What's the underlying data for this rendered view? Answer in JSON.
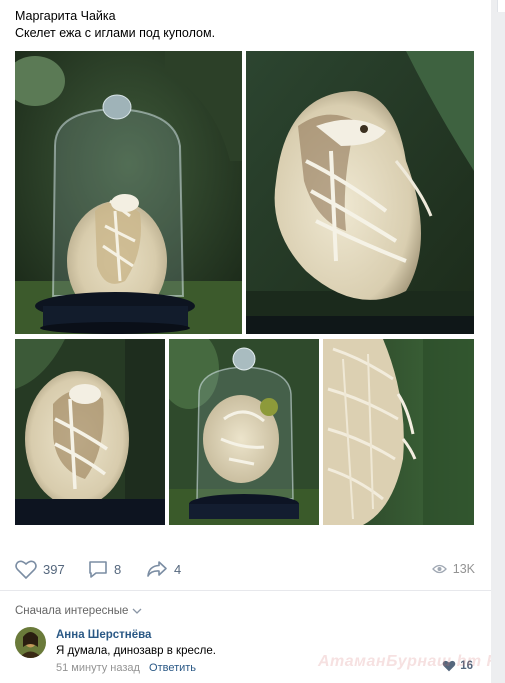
{
  "post": {
    "author": "Маргарита Чайка",
    "text": "Скелет ежа с иглами под куполом."
  },
  "photos": [
    {
      "subject": "skeleton-under-glass-dome"
    },
    {
      "subject": "skeleton-closeup"
    },
    {
      "subject": "skeleton-side"
    },
    {
      "subject": "dome-with-skeleton"
    },
    {
      "subject": "quills-closeup"
    }
  ],
  "actions": {
    "likes": "397",
    "comments": "8",
    "shares": "4",
    "views": "13K"
  },
  "comments_sort": "Сначала интересные",
  "comment": {
    "author": "Анна Шерстнёва",
    "text": "Я думала, динозавр в кресле.",
    "time": "51 минуту назад",
    "reply_label": "Ответить",
    "likes": "16"
  },
  "watermark": "АтаманБурнаш bm RU"
}
